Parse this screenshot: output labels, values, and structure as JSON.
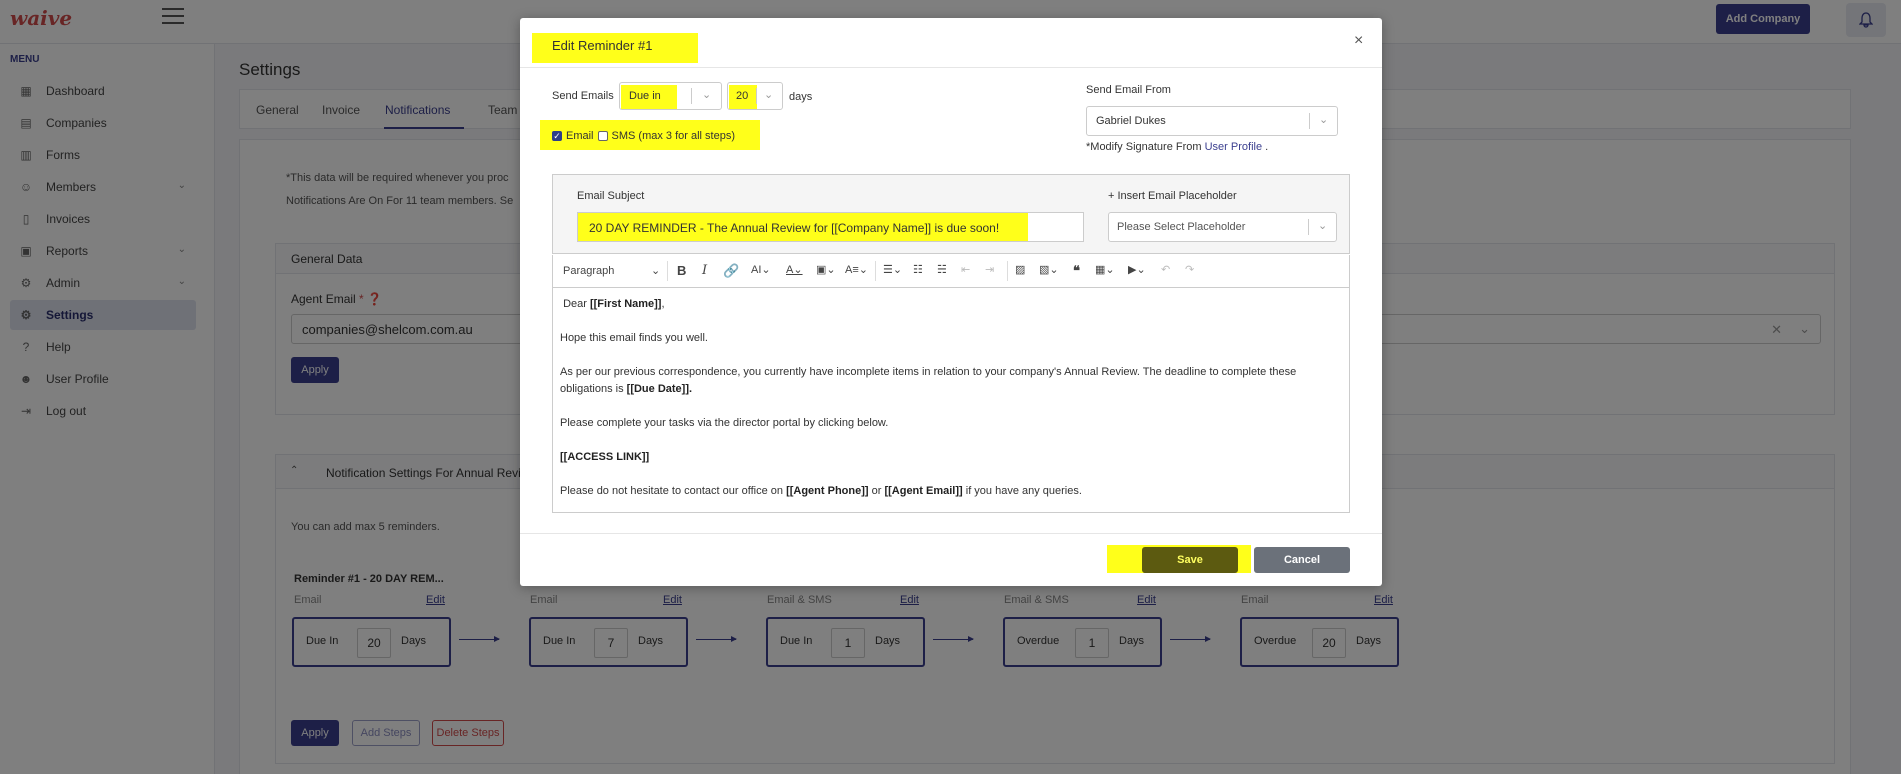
{
  "app": {
    "logo": "waive",
    "add_company": "Add Company"
  },
  "sidebar": {
    "menu_label": "MENU",
    "items": [
      {
        "label": "Dashboard",
        "icon": "grid-icon"
      },
      {
        "label": "Companies",
        "icon": "building-icon"
      },
      {
        "label": "Forms",
        "icon": "form-icon"
      },
      {
        "label": "Members",
        "icon": "users-icon"
      },
      {
        "label": "Invoices",
        "icon": "document-icon"
      },
      {
        "label": "Reports",
        "icon": "report-icon"
      },
      {
        "label": "Admin",
        "icon": "admin-icon"
      },
      {
        "label": "Settings",
        "icon": "gear-icon"
      },
      {
        "label": "Help",
        "icon": "help-icon"
      },
      {
        "label": "User Profile",
        "icon": "user-icon"
      },
      {
        "label": "Log out",
        "icon": "logout-icon"
      }
    ]
  },
  "page": {
    "title": "Settings",
    "tabs": [
      "General",
      "Invoice",
      "Notifications",
      "Team"
    ],
    "note1": "*This data will be required whenever you proc",
    "note2_prefix": "Notifications Are On For ",
    "note2_count": "11",
    "note2_suffix": " team members. Se",
    "general_data": {
      "header": "General Data",
      "agent_label": "Agent Email",
      "agent_req": "*",
      "agent_value": "companies@shelcom.com.au",
      "apply": "Apply"
    },
    "notification_settings": {
      "header": "Notification Settings For Annual Revie",
      "sub": "You can add max 5 reminders.",
      "reminder_head": "Reminder #1 - 20 DAY REM...",
      "edit_label": "Edit",
      "days_label": "Days",
      "steps": [
        {
          "type": "Email",
          "kind": "Due In",
          "num": "20"
        },
        {
          "type": "Email",
          "kind": "Due In",
          "num": "7"
        },
        {
          "type": "Email & SMS",
          "kind": "Due In",
          "num": "1"
        },
        {
          "type": "Email & SMS",
          "kind": "Overdue",
          "num": "1"
        },
        {
          "type": "Email",
          "kind": "Overdue",
          "num": "20"
        }
      ],
      "apply": "Apply",
      "add_steps": "Add Steps",
      "delete_steps": "Delete Steps"
    }
  },
  "modal": {
    "title": "Edit Reminder #1",
    "close": "×",
    "send_emails_label": "Send Emails",
    "timing": "Due in",
    "days_value": "20",
    "days_label": "days",
    "email_label": "Email",
    "sms_label": "SMS (max 3 for all steps)",
    "send_from_label": "Send Email From",
    "send_from_value": "Gabriel Dukes",
    "sig_prefix": "*Modify Signature From ",
    "sig_link": "User Profile",
    "sig_suffix": " .",
    "subject_label": "Email Subject",
    "subject_value": "20 DAY REMINDER - The Annual Review for [[Company Name]] is due soon!",
    "placeholder_label": "+ Insert Email Placeholder",
    "placeholder_select": "Please Select Placeholder",
    "toolbar_paragraph": "Paragraph",
    "body": {
      "greeting_prefix": "Dear ",
      "greeting_bold": "[[First Name]]",
      "greeting_suffix": ",",
      "p1": "Hope this email finds you well.",
      "p2": "As per our previous correspondence, you currently have incomplete items in relation to your company's Annual Review. The deadline to complete these obligations is ",
      "p2_bold": "[[Due Date]].",
      "p3": "Please complete your tasks via the director portal by clicking below.",
      "p4_bold": "[[ACCESS LINK]]",
      "p5_prefix": "Please do not hesitate to contact our office on ",
      "p5_bold1": "[[Agent Phone]]",
      "p5_mid": " or ",
      "p5_bold2": "[[Agent Email]]",
      "p5_suffix": " if you have any queries."
    },
    "save": "Save",
    "cancel": "Cancel"
  },
  "colors": {
    "accent": "#3b3f8f",
    "highlight": "#ffff1a",
    "danger": "#d14a4a"
  }
}
